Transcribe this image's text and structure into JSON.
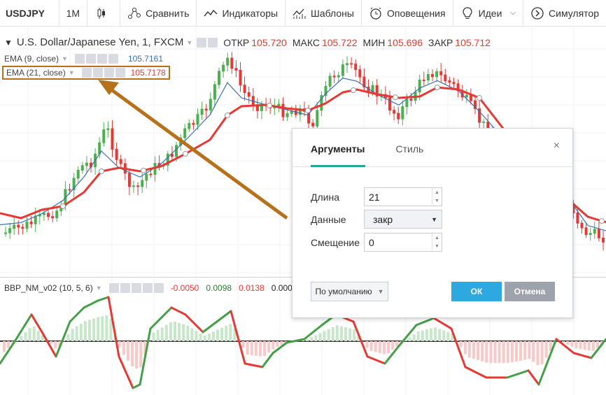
{
  "toolbar": {
    "symbol": "USDJPY",
    "interval": "1M",
    "compare": "Сравнить",
    "indicators": "Индикаторы",
    "templates": "Шаблоны",
    "alerts": "Оповещения",
    "ideas": "Идеи",
    "simulator": "Симулятор",
    "icons": [
      "candles-icon",
      "compare-icon",
      "indicators-icon",
      "templates-icon",
      "alert-clock-icon",
      "lightbulb-icon",
      "replay-icon"
    ]
  },
  "legend": {
    "title": "U.S. Dollar/Japanese Yen, 1, FXCM",
    "open_label": "ОТКР",
    "open": "105.720",
    "high_label": "МАКС",
    "high": "105.722",
    "low_label": "МИН",
    "low": "105.696",
    "close_label": "ЗАКР",
    "close": "105.712"
  },
  "ema9": {
    "name": "EMA (9, close)",
    "value": "105.7161",
    "color": "#3b6eb5"
  },
  "ema21": {
    "name": "EMA (21, close)",
    "value": "105.7178",
    "color": "#e53935"
  },
  "bbp": {
    "name": "BBP_NM_v02 (10, 5, 6)",
    "v1": "-0.0050",
    "v2": "0.0098",
    "v3": "0.0138",
    "v4": "0.0000"
  },
  "dialog": {
    "tab_args": "Аргументы",
    "tab_style": "Стиль",
    "close": "×",
    "length_label": "Длина",
    "length_value": "21",
    "source_label": "Данные",
    "source_value": "закр",
    "offset_label": "Смещение",
    "offset_value": "0",
    "defaults": "По умолчанию",
    "ok": "ОК",
    "cancel": "Отмена"
  },
  "colors": {
    "up": "#4caf50",
    "down": "#e53935",
    "ema21": "#e53935",
    "ema9": "#3b6eb5",
    "accent": "#26a69a",
    "annotation_arrow": "#b8711b"
  }
}
